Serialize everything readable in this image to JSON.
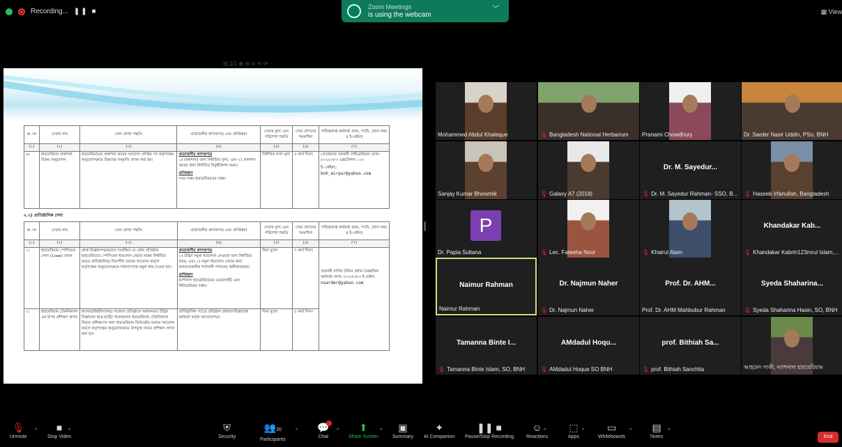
{
  "topbar": {
    "recording_label": "Recording...",
    "recording_controls": "❚❚ ■",
    "webcam_line1": "Zoom Meetings",
    "webcam_line2": "is using the webcam",
    "view_label": "View"
  },
  "doc": {
    "toolbar_text": "⊟ 1/1 ⊕ ⊖ ⊙ ⟲ ⟳",
    "table_headers": [
      "ক্র. নং",
      "সেবার নাম",
      "সেবা প্রদান পদ্ধতি",
      "প্রয়োজনীয় কাগজপত্র এবং প্রাপ্তিস্থান",
      "সেবার মূল্য এবং পরিশোধ পদ্ধতি",
      "সেবা প্রদানের সময়সীমা",
      "দায়িত্বপ্রাপ্ত কর্মকর্তা (নাম, পদবি, ফোন নম্বর ও ই-মেইল)"
    ],
    "col_numbers": [
      "(১)",
      "(২)",
      "(৩)",
      "(৪)",
      "(৫)",
      "(৬)",
      "(৭)"
    ],
    "row1": {
      "no": "৬।",
      "name": "হারবেরিয়াম প্রকাশনা বিক্রয় অনুমোদন",
      "method": "হারবেরিয়ামের প্রকাশনা ক্রয়ের আবেদন প্রাপ্তির পর কর্তৃপক্ষের অনুমোদনক্রমে বিক্রয়ের অনুমতি প্রদান করা হয়।",
      "docs_title": "প্রয়োজনীয় কাগজপত্র",
      "docs": "১) প্রকাশনার জন্য নির্ধারিত মূল্য; এবং ২) প্রকাশনা ক্রয়ের জন্য নির্ধারিত রিকুইজিশন ফরম।",
      "place_title": "প্রাপ্তিস্থান",
      "place": "সদর দপ্তর হারবেরিয়ামের দপ্তর।",
      "fee": "নির্ধারিত নগদ মূল্য",
      "time": "৫ কার্য দিবস",
      "officer": "প্রোগ্রাম্যার সহকারী লাইব্রেরিয়ান ফোন: ৮০২৫৩৮৩ এক্সটেনশন ১২০",
      "officer_email": "ই-মেইল: bnh_mirpur@yahoo.com"
    },
    "section_title": "২.২) প্রাতিষ্ঠানিক সেবা",
    "row2": {
      "no": "১।",
      "name": "হারবেরিয়াম স্পেসিমেন লোন (Loan) প্রদান",
      "method": "প্রাপ্ত বিজ্ঞানসম্মতভাবে সংরক্ষিত যে কোন প্রতিষ্ঠান হারবেরিয়ামে স্পেসিমেন ধারলোন নেয়ার লক্ষ্যে নির্ধারিত ফরমে প্রাতিষ্ঠানিক/ বিভাগীয় বরাবর আবেদন করলে কর্তৃপক্ষের অনুমোদনক্রমে শর্তসাপেক্ষে নমুনা ধার দেওয়া হয়।",
      "docs_title": "প্রয়োজনীয় কাগজপত্র",
      "docs": "১) উদ্ভিদ নমুনা ধারলোন নেওয়ার জন্য নির্ধারিত ফরম; এবং ২) নমুনা ধারলোন নেয়ার জন্য আবেদনকারীর শর্তাবলী পালনের অঙ্গীকারনামা।",
      "place_title": "প্রাপ্তিস্থান",
      "place": "ন্যাশনাল হারবেরিয়ামের ওয়েবসাইট এবং কিউরেটরের দপ্তর।",
      "fee": "বিনা মূল্যে",
      "time": "৭ কার্য দিবস",
      "officer": "সহকারী নাসির উদ্দিন প্রধান বৈজ্ঞানিক কর্মকর্তা ফোন: ৮০২৫৩৮৩ ই-মেইল:",
      "officer_email": "nsarder@yahoo.com"
    },
    "row3": {
      "no": "২।",
      "name": "হারবেরিয়াম টেকনিক্যাল এর উপর প্রশিক্ষণ প্রদান",
      "method": "কলেজ/বিশ্ববিদ্যালয়/ গবেষণা প্রতিষ্ঠানে অধ্যয়নরত উদ্ভিদ বিজ্ঞানের ছাত্র-ছাত্রী/ গবেষকদের হারবেরিয়াম টেকনিক্যাল বিষয়ে প্রশিক্ষণের জন্য হারবেরিয়াম কিউরেটর বরাবর আবেদন করলে কর্তৃপক্ষের অনুমোদনক্রমে উপযুক্ত সময়ে প্রশিক্ষণ প্রদান করা হয়।",
      "docs": "প্রাতিষ্ঠানিক প্যাডে প্রতিষ্ঠান প্রধান/দায়িত্বপ্রাপ্ত কর্মকর্তা কর্তৃক আবেদনপত্র।",
      "fee": "বিনা মূল্যে",
      "time": "৫ কার্য দিবস"
    }
  },
  "gallery": [
    {
      "label": "Mohammed Abdul Khaleque",
      "muted": false,
      "kind": "photo",
      "photo": "p1"
    },
    {
      "label": "Bangladesh National Herbarium",
      "muted": true,
      "kind": "photo",
      "photo": "p2"
    },
    {
      "label": "Pranami Chowdhury",
      "muted": false,
      "kind": "photo",
      "photo": "p3"
    },
    {
      "label": "Dr. Sarder Nasir Uddin, PSo, BNH",
      "muted": false,
      "kind": "photo",
      "photo": "p4"
    },
    {
      "label": "Sanjay Kumar Bhowmik",
      "muted": false,
      "kind": "photo",
      "photo": "p5"
    },
    {
      "label": "Galaxy A7 (2018)",
      "muted": true,
      "kind": "photo",
      "photo": "p6"
    },
    {
      "label": "Dr. M. Sayedur Rahman- SSO, B...",
      "muted": true,
      "kind": "name",
      "big": "Dr. M. Sayedur..."
    },
    {
      "label": "Haseeb Irfanullah, Bangladesh",
      "muted": true,
      "kind": "photo",
      "photo": "p8"
    },
    {
      "label": "Dr. Papia Sultana",
      "muted": false,
      "kind": "avatar",
      "initial": "P"
    },
    {
      "label": "Lec. Fateeha Noor",
      "muted": true,
      "kind": "photo",
      "photo": "p10"
    },
    {
      "label": "Khairul Alam",
      "muted": true,
      "kind": "photo",
      "photo": "p11"
    },
    {
      "label": "Khandakar Kabnh123mrul Islam,...",
      "muted": true,
      "kind": "name",
      "big": "Khandakar Kab..."
    },
    {
      "label": "Naimur Rahman",
      "muted": false,
      "kind": "name",
      "big": "Naimur Rahman",
      "active": true
    },
    {
      "label": "Dr. Najmun Naher",
      "muted": true,
      "kind": "name",
      "big": "Dr. Najmun Naher"
    },
    {
      "label": "Prof. Dr. AHM Mahbubur Rahman",
      "muted": false,
      "kind": "name",
      "big": "Prof. Dr. AHM..."
    },
    {
      "label": "Syeda Shaharina Hasin, SO, BNH",
      "muted": true,
      "kind": "name",
      "big": "Syeda Shaharina..."
    },
    {
      "label": "Tamanna Binte Islam, SO, BNH",
      "muted": true,
      "kind": "name",
      "big": "Tamanna Binte I..."
    },
    {
      "label": "AMdadul Hoque SO BNH",
      "muted": true,
      "kind": "name",
      "big": "AMdadul Hoqu..."
    },
    {
      "label": "prof. Bithiah Sanchita",
      "muted": true,
      "kind": "name",
      "big": "prof. Bithiah Sa..."
    },
    {
      "label": "আহমেদ সাকী, ন্যাশনাল হারবেরিয়াম",
      "muted": false,
      "kind": "photo",
      "photo": "p20"
    }
  ],
  "toolbar": {
    "unmute": "Unmute",
    "stop_video": "Stop Video",
    "security": "Security",
    "participants": "Participants",
    "participants_count": "20",
    "chat": "Chat",
    "share_screen": "Share Screen",
    "summary": "Summary",
    "ai_companion": "AI Companion",
    "pause_recording": "Pause/Stop Recording",
    "reactions": "Reactions",
    "apps": "Apps",
    "whiteboards": "Whiteboards",
    "notes": "Notes",
    "end": "End"
  },
  "colors": {
    "accent_green": "#23c157",
    "muted_red": "#e0252a",
    "active_speaker_border": "#d5df84",
    "end_red": "#d42e2e"
  }
}
